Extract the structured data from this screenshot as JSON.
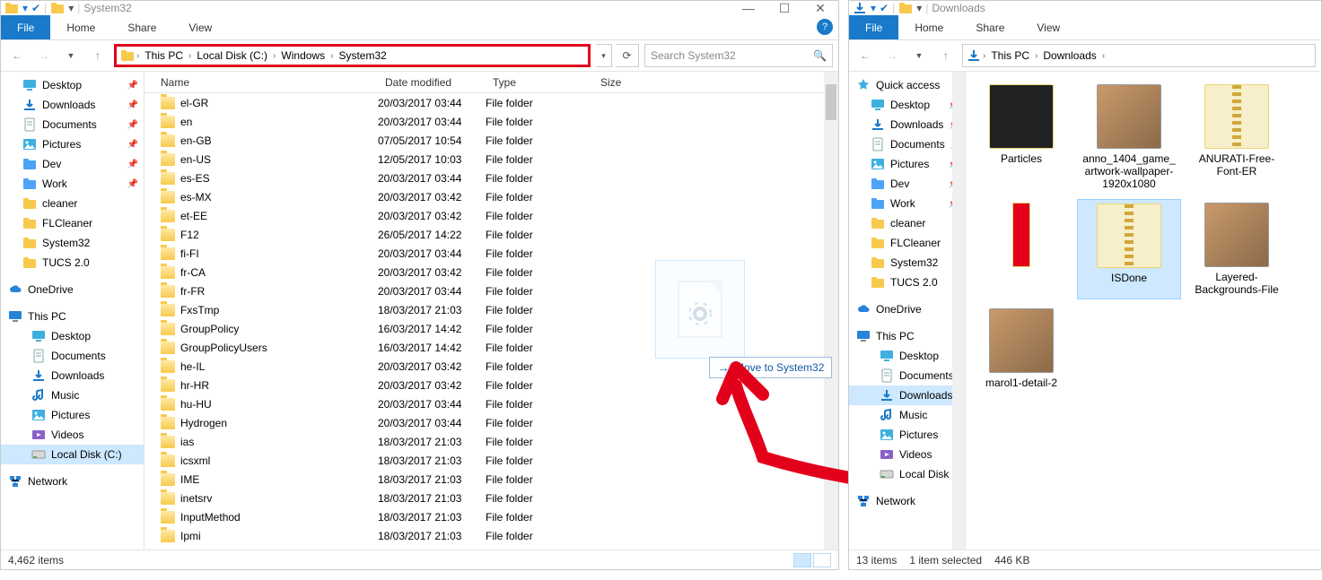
{
  "left": {
    "title": "System32",
    "tabs": {
      "file": "File",
      "home": "Home",
      "share": "Share",
      "view": "View"
    },
    "breadcrumbs": [
      "This PC",
      "Local Disk (C:)",
      "Windows",
      "System32"
    ],
    "search_placeholder": "Search System32",
    "columns": {
      "name": "Name",
      "date": "Date modified",
      "type": "Type",
      "size": "Size"
    },
    "nav_quick": [
      {
        "label": "Desktop",
        "icon": "desktop",
        "pinned": true
      },
      {
        "label": "Downloads",
        "icon": "downloads",
        "pinned": true
      },
      {
        "label": "Documents",
        "icon": "documents",
        "pinned": true
      },
      {
        "label": "Pictures",
        "icon": "pictures",
        "pinned": true
      },
      {
        "label": "Dev",
        "icon": "folder-blue",
        "pinned": true
      },
      {
        "label": "Work",
        "icon": "folder-blue",
        "pinned": true
      },
      {
        "label": "cleaner",
        "icon": "folder"
      },
      {
        "label": "FLCleaner",
        "icon": "folder"
      },
      {
        "label": "System32",
        "icon": "folder"
      },
      {
        "label": "TUCS 2.0",
        "icon": "folder"
      }
    ],
    "nav_onedrive": "OneDrive",
    "nav_thispc": "This PC",
    "nav_pc": [
      {
        "label": "Desktop",
        "icon": "desktop"
      },
      {
        "label": "Documents",
        "icon": "documents"
      },
      {
        "label": "Downloads",
        "icon": "downloads"
      },
      {
        "label": "Music",
        "icon": "music"
      },
      {
        "label": "Pictures",
        "icon": "pictures"
      },
      {
        "label": "Videos",
        "icon": "videos"
      },
      {
        "label": "Local Disk (C:)",
        "icon": "disk",
        "selected": true
      }
    ],
    "nav_network": "Network",
    "rows": [
      {
        "name": "el-GR",
        "date": "20/03/2017 03:44",
        "type": "File folder"
      },
      {
        "name": "en",
        "date": "20/03/2017 03:44",
        "type": "File folder"
      },
      {
        "name": "en-GB",
        "date": "07/05/2017 10:54",
        "type": "File folder"
      },
      {
        "name": "en-US",
        "date": "12/05/2017 10:03",
        "type": "File folder"
      },
      {
        "name": "es-ES",
        "date": "20/03/2017 03:44",
        "type": "File folder"
      },
      {
        "name": "es-MX",
        "date": "20/03/2017 03:42",
        "type": "File folder"
      },
      {
        "name": "et-EE",
        "date": "20/03/2017 03:42",
        "type": "File folder"
      },
      {
        "name": "F12",
        "date": "26/05/2017 14:22",
        "type": "File folder"
      },
      {
        "name": "fi-FI",
        "date": "20/03/2017 03:44",
        "type": "File folder"
      },
      {
        "name": "fr-CA",
        "date": "20/03/2017 03:42",
        "type": "File folder"
      },
      {
        "name": "fr-FR",
        "date": "20/03/2017 03:44",
        "type": "File folder"
      },
      {
        "name": "FxsTmp",
        "date": "18/03/2017 21:03",
        "type": "File folder"
      },
      {
        "name": "GroupPolicy",
        "date": "16/03/2017 14:42",
        "type": "File folder"
      },
      {
        "name": "GroupPolicyUsers",
        "date": "16/03/2017 14:42",
        "type": "File folder"
      },
      {
        "name": "he-IL",
        "date": "20/03/2017 03:42",
        "type": "File folder"
      },
      {
        "name": "hr-HR",
        "date": "20/03/2017 03:42",
        "type": "File folder"
      },
      {
        "name": "hu-HU",
        "date": "20/03/2017 03:44",
        "type": "File folder"
      },
      {
        "name": "Hydrogen",
        "date": "20/03/2017 03:44",
        "type": "File folder"
      },
      {
        "name": "ias",
        "date": "18/03/2017 21:03",
        "type": "File folder"
      },
      {
        "name": "icsxml",
        "date": "18/03/2017 21:03",
        "type": "File folder"
      },
      {
        "name": "IME",
        "date": "18/03/2017 21:03",
        "type": "File folder"
      },
      {
        "name": "inetsrv",
        "date": "18/03/2017 21:03",
        "type": "File folder"
      },
      {
        "name": "InputMethod",
        "date": "18/03/2017 21:03",
        "type": "File folder"
      },
      {
        "name": "Ipmi",
        "date": "18/03/2017 21:03",
        "type": "File folder"
      }
    ],
    "status": "4,462 items",
    "drag_tip": "Move to System32"
  },
  "right": {
    "title": "Downloads",
    "tabs": {
      "file": "File",
      "home": "Home",
      "share": "Share",
      "view": "View"
    },
    "breadcrumbs": [
      "This PC",
      "Downloads"
    ],
    "nav_quick_label": "Quick access",
    "nav_quick": [
      {
        "label": "Desktop",
        "icon": "desktop",
        "pinned": true
      },
      {
        "label": "Downloads",
        "icon": "downloads",
        "pinned": true
      },
      {
        "label": "Documents",
        "icon": "documents",
        "pinned": true
      },
      {
        "label": "Pictures",
        "icon": "pictures",
        "pinned": true
      },
      {
        "label": "Dev",
        "icon": "folder-blue",
        "pinned": true
      },
      {
        "label": "Work",
        "icon": "folder-blue",
        "pinned": true
      },
      {
        "label": "cleaner",
        "icon": "folder"
      },
      {
        "label": "FLCleaner",
        "icon": "folder"
      },
      {
        "label": "System32",
        "icon": "folder"
      },
      {
        "label": "TUCS 2.0",
        "icon": "folder"
      }
    ],
    "nav_onedrive": "OneDrive",
    "nav_thispc": "This PC",
    "nav_pc": [
      {
        "label": "Desktop",
        "icon": "desktop"
      },
      {
        "label": "Documents",
        "icon": "documents"
      },
      {
        "label": "Downloads",
        "icon": "downloads",
        "selected": true
      },
      {
        "label": "Music",
        "icon": "music"
      },
      {
        "label": "Pictures",
        "icon": "pictures"
      },
      {
        "label": "Videos",
        "icon": "videos"
      },
      {
        "label": "Local Disk (C:)",
        "icon": "disk"
      }
    ],
    "nav_network": "Network",
    "items": [
      {
        "label": "Particles",
        "kind": "dark"
      },
      {
        "label": "anno_1404_game_artwork-wallpaper-1920x1080",
        "kind": "img"
      },
      {
        "label": "ANURATI-Free-Font-ER",
        "kind": "zip"
      },
      {
        "label": "",
        "kind": "red"
      },
      {
        "label": "ISDone",
        "kind": "zip",
        "selected": true
      },
      {
        "label": "Layered-Backgrounds-File",
        "kind": "img"
      },
      {
        "label": "marol1-detail-2",
        "kind": "img"
      }
    ],
    "status_items": "13 items",
    "status_sel": "1 item selected",
    "status_size": "446 KB"
  }
}
